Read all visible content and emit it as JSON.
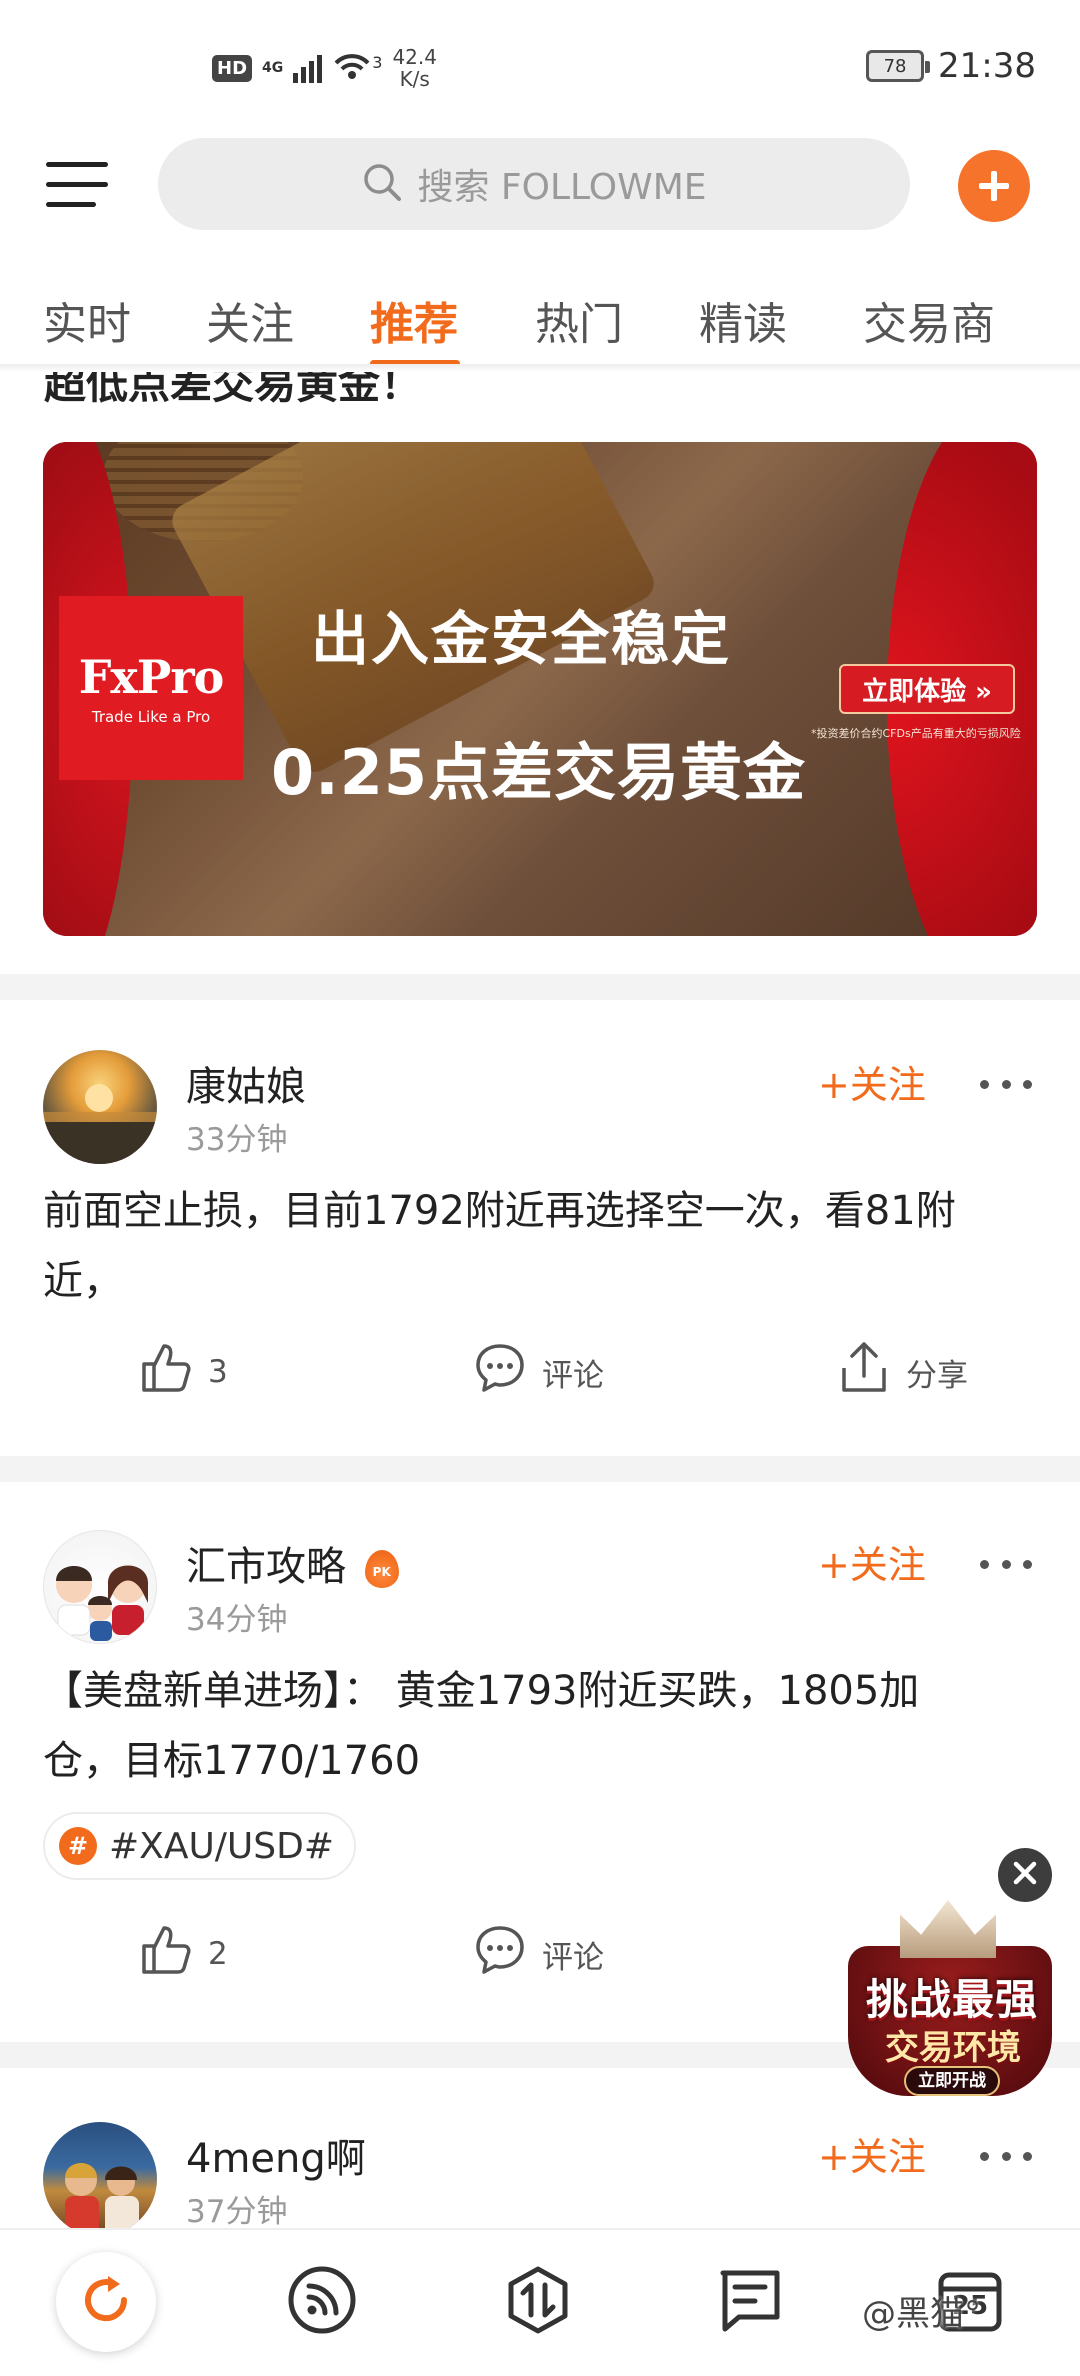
{
  "status_bar": {
    "hd": "HD",
    "network": "4G",
    "wifi_badge": "3",
    "speed_value": "42.4",
    "speed_unit": "K/s",
    "battery": "78",
    "time": "21:38"
  },
  "header": {
    "search_placeholder": "搜索 FOLLOWME"
  },
  "tabs": [
    {
      "label": "实时",
      "active": false
    },
    {
      "label": "关注",
      "active": false
    },
    {
      "label": "推荐",
      "active": true
    },
    {
      "label": "热门",
      "active": false
    },
    {
      "label": "精读",
      "active": false
    },
    {
      "label": "交易商",
      "active": false
    }
  ],
  "ad": {
    "title": "超低点差交易黄金！",
    "logo": "FxPro",
    "logo_tagline": "Trade Like a Pro",
    "headline1": "出入金安全稳定",
    "headline2": "0.25点差交易黄金",
    "cta": "立即体验 »",
    "disclaimer": "*投资差价合约CFDs产品有重大的亏损风险"
  },
  "posts": [
    {
      "username": "康姑娘",
      "time": "33分钟",
      "follow": "+关注",
      "body_line1": "前面空止损，目前1792附近再选择空一次，看81附",
      "body_line2": "近，",
      "likes": "3",
      "comment": "评论",
      "share": "分享"
    },
    {
      "username": "汇市攻略",
      "badge": "PK",
      "time": "34分钟",
      "follow": "+关注",
      "body_line1": "【美盘新单进场】：  黄金1793附近买跌，1805加",
      "body_line2": "仓，目标1770/1760",
      "hashtag_symbol": "#",
      "hashtag": "#XAU/USD#",
      "likes": "2",
      "comment": "评论"
    },
    {
      "username": "4meng啊",
      "time": "37分钟",
      "follow": "+关注"
    }
  ],
  "promo": {
    "line1": "挑战最强",
    "line2": "交易环境",
    "cta": "立即开战"
  },
  "bottom_nav": {
    "icons": [
      "refresh-icon",
      "feed-icon",
      "trade-icon",
      "message-icon",
      "calendar-icon"
    ],
    "calendar_day": "25",
    "watermark": "@黑猫°"
  },
  "colors": {
    "accent": "#f26b1d",
    "follow": "#f26b1d",
    "banner_red": "#e01b22"
  }
}
